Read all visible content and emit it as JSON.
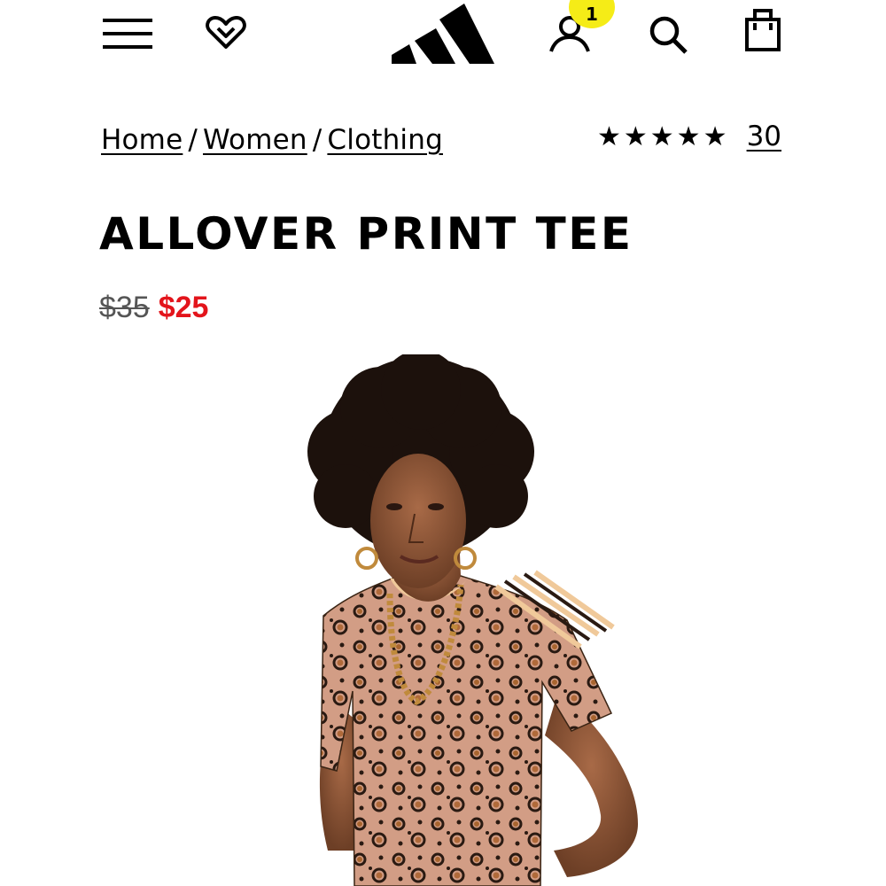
{
  "header": {
    "menu_icon": "hamburger-menu-icon",
    "wishlist_icon": "heart-icon",
    "logo": "adidas-logo",
    "account_icon": "user-icon",
    "account_badge": "1",
    "search_icon": "search-icon",
    "bag_icon": "shopping-bag-icon"
  },
  "breadcrumb": {
    "items": [
      "Home",
      "Women",
      "Clothing"
    ],
    "separator": "/"
  },
  "rating": {
    "stars": "★★★★★",
    "value": 5,
    "review_count": "30"
  },
  "product": {
    "title": "ALLOVER PRINT TEE",
    "original_price": "$35",
    "sale_price": "$25",
    "image": "model-wearing-leopard-print-tee"
  },
  "colors": {
    "sale": "#e3141b",
    "badge": "#f5ec17",
    "text": "#000000"
  }
}
